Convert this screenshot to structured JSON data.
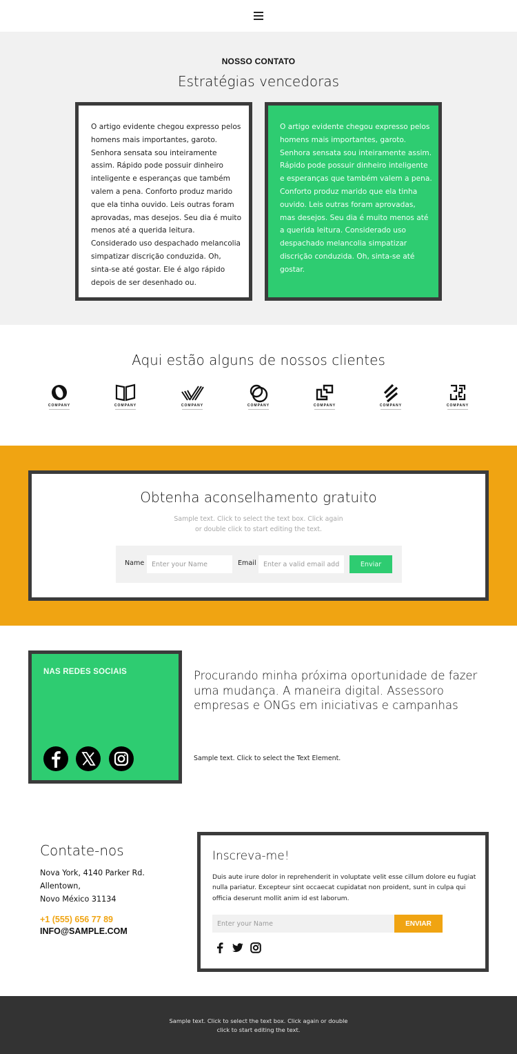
{
  "header": {
    "menu_icon": "hamburger-menu-icon"
  },
  "intro": {
    "eyebrow": "NOSSO CONTATO",
    "title": "Estratégias vencedoras",
    "card_left_text": "O artigo evidente chegou expresso pelos homens mais importantes, garoto. Senhora sensata sou inteiramente assim. Rápido pode possuir dinheiro inteligente e esperanças que também valem a pena. Conforto produz marido que ela tinha ouvido. Leis outras foram aprovadas, mas desejos. Seu dia é muito menos até a querida leitura. Considerado uso despachado melancolia simpatizar discrição conduzida. Oh, sinta-se até gostar. Ele é algo rápido depois de ser desenhado ou.",
    "card_right_text": "O artigo evidente chegou expresso pelos homens mais importantes, garoto. Senhora sensata sou inteiramente assim. Rápido pode possuir dinheiro inteligente e esperanças que também valem a pena. Conforto produz marido que ela tinha ouvido. Leis outras foram aprovadas, mas desejos. Seu dia é muito menos até a querida leitura. Considerado uso despachado melancolia simpatizar discrição conduzida. Oh, sinta-se até gostar."
  },
  "clients": {
    "title": "Aqui estão alguns de nossos clientes",
    "logos": [
      {
        "caption": "COMPANY",
        "icon": "ring-logo-icon"
      },
      {
        "caption": "COMPANY",
        "icon": "book-logo-icon"
      },
      {
        "caption": "COMPANY",
        "icon": "stripes-v-logo-icon"
      },
      {
        "caption": "COMPANY",
        "icon": "circles-logo-icon"
      },
      {
        "caption": "COMPANY",
        "icon": "squares-logo-icon"
      },
      {
        "caption": "COMPANY",
        "icon": "slashes-logo-icon"
      },
      {
        "caption": "COMPANY",
        "icon": "maze-logo-icon"
      }
    ]
  },
  "advice": {
    "title": "Obtenha aconselhamento gratuito",
    "subtitle_line1": "Sample text. Click to select the text box. Click again",
    "subtitle_line2": "or double click to start editing the text.",
    "name_label": "Name",
    "name_placeholder": "Enter your Name",
    "email_label": "Email",
    "email_placeholder": "Enter a valid email address",
    "submit_label": "Enviar"
  },
  "social": {
    "title": "NAS REDES SOCIAIS",
    "icons": [
      "facebook-icon",
      "x-twitter-icon",
      "instagram-icon"
    ],
    "headline": "Procurando minha próxima oportunidade de fazer uma mudança. A maneira digital. Assessoro empresas e ONGs em iniciativas e campanhas",
    "sample_text": "Sample text. Click to select the Text Element."
  },
  "contact": {
    "title": "Contate-nos",
    "address_line1": "Nova York, 4140 Parker Rd.",
    "address_line2": "Allentown,",
    "address_line3": "Novo México 31134",
    "phone": "+1 (555) 656 77 89",
    "email": "INFO@SAMPLE.COM"
  },
  "subscribe": {
    "title": "Inscreva-me!",
    "body": "Duis aute irure dolor in reprehenderit in voluptate velit esse cillum dolore eu fugiat nulla pariatur. Excepteur sint occaecat cupidatat non proident, sunt in culpa qui officia deserunt mollit anim id est laborum.",
    "name_placeholder": "Enter your Name",
    "submit_label": "ENVIAR",
    "icons": [
      "facebook-icon",
      "twitter-icon",
      "instagram-icon"
    ]
  },
  "footer": {
    "line1": "Sample text. Click to select the text box. Click again or double",
    "line2": "click to start editing the text."
  },
  "colors": {
    "green": "#2ecc71",
    "orange": "#f0a412",
    "dark": "#333333",
    "gray_bg": "#f1f1f1",
    "border": "#3b3b3b"
  }
}
